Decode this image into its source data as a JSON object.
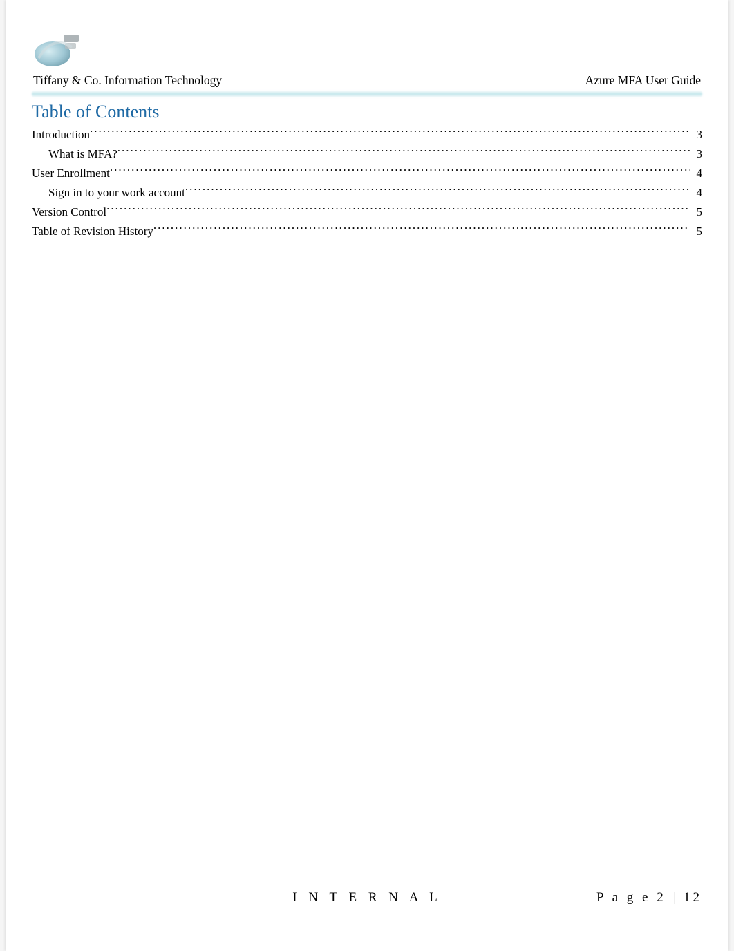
{
  "header": {
    "left": "Tiffany & Co. Information Technology",
    "right": "Azure MFA User Guide"
  },
  "toc": {
    "title": "Table of Contents",
    "entries": [
      {
        "label": "Introduction",
        "page": "3",
        "level": 1
      },
      {
        "label": "What is MFA?",
        "page": "3",
        "level": 2
      },
      {
        "label": "User Enrollment",
        "page": "4",
        "level": 1
      },
      {
        "label": "Sign in to your work account",
        "page": "4",
        "level": 2
      },
      {
        "label": "Version Control",
        "page": "5",
        "level": 1
      },
      {
        "label": "Table of Revision History",
        "page": "5",
        "level": 1
      }
    ]
  },
  "footer": {
    "classification": "I N T E R N A L",
    "page_label": "P a g e",
    "page_current": "2",
    "page_total": "12",
    "separator": "|"
  }
}
